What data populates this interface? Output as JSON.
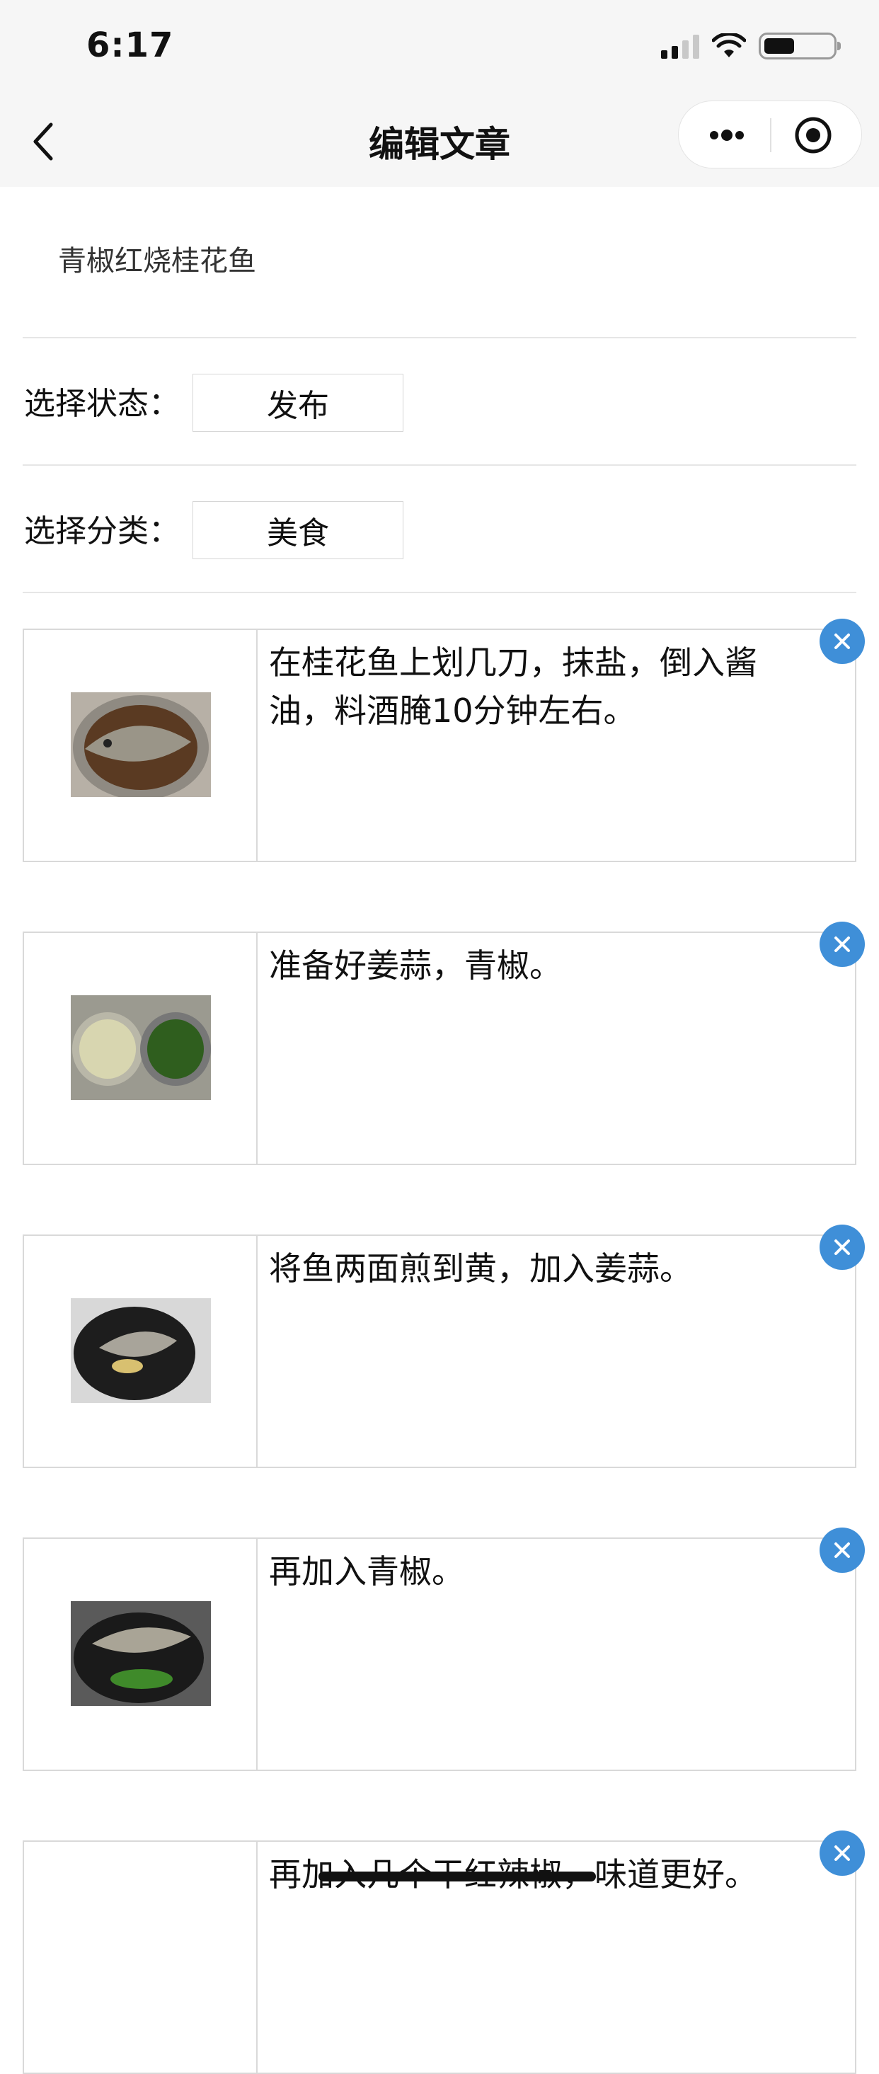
{
  "status_bar": {
    "time": "6:17"
  },
  "nav": {
    "title": "编辑文章"
  },
  "article": {
    "title": "青椒红烧桂花鱼"
  },
  "status_row": {
    "label": "选择状态：",
    "value": "发布"
  },
  "category_row": {
    "label": "选择分类：",
    "value": "美食"
  },
  "steps": [
    {
      "text": "在桂花鱼上划几刀，抹盐，倒入酱油，料酒腌10分钟左右。"
    },
    {
      "text": "准备好姜蒜，青椒。"
    },
    {
      "text": "将鱼两面煎到黄，加入姜蒜。"
    },
    {
      "text": "再加入青椒。"
    },
    {
      "text": "再加入几个干红辣椒，味道更好。"
    }
  ],
  "colors": {
    "accent": "#3f8fd8",
    "nav_bg": "#f6f6f6"
  }
}
